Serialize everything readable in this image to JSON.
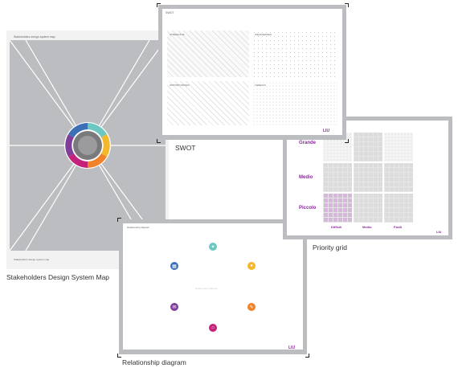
{
  "captions": {
    "stakeholders": "Stakeholders Design System Map",
    "swot": "SWOT",
    "priority": "Priority grid",
    "relationship": "Relationship diagram"
  },
  "stakeholders": {
    "header": "Stakeholders design system map",
    "footer": "Stakeholders design system map"
  },
  "swot": {
    "header": "SWOT",
    "q1": "STRENGTHS",
    "q2": "WEAKNESSES",
    "q3": "OPPORTUNITIES",
    "q4": "THREATS",
    "brand": "LIU"
  },
  "priority": {
    "rows": [
      "Grande",
      "Medio",
      "Piccolo"
    ],
    "cols": [
      "Difficili",
      "Medio",
      "Facili"
    ],
    "brand": "LIU"
  },
  "relationship": {
    "header": "Relationship diagram",
    "center": "Relationship diagram",
    "brand": "LIU",
    "colors": {
      "teal": "#6cc7c0",
      "yellow": "#f4b82c",
      "orange": "#f0822a",
      "magenta": "#c3217a",
      "purple": "#7f3f98",
      "blue": "#3b6fb6"
    }
  }
}
